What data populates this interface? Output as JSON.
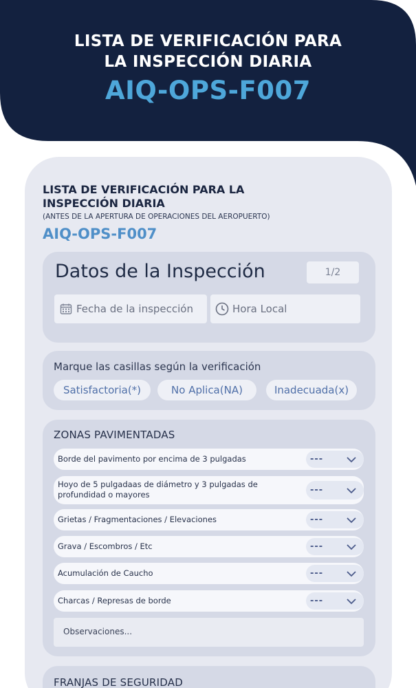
{
  "header": {
    "title_line1": "LISTA DE VERIFICACIÓN PARA",
    "title_line2": "LA INSPECCIÓN DIARIA",
    "code": "AIQ-OPS-F007"
  },
  "document": {
    "title_line1": "LISTA DE VERIFICACIÓN PARA LA",
    "title_line2": "INSPECCIÓN DIARIA",
    "subtitle": "(ANTES DE LA APERTURA DE OPERACIONES DEL AEROPUERTO)",
    "code": "AIQ-OPS-F007"
  },
  "inspection": {
    "title": "Datos de la Inspección",
    "page_indicator": "1/2",
    "date_placeholder": "Fecha de la  inspección",
    "time_placeholder": "Hora Local"
  },
  "legend": {
    "instruction": "Marque las casillas según la verificación",
    "options": [
      "Satisfactoria(*)",
      "No Aplica(NA)",
      "Inadecuada(x)"
    ]
  },
  "paved_zones": {
    "title": "ZONAS PAVIMENTADAS",
    "items": [
      {
        "label": "Borde del pavimento por encima de 3 pulgadas",
        "value": "---"
      },
      {
        "label": "Hoyo de 5 pulgadaas de diámetro y 3 pulgadas de",
        "label2": "profundidad o mayores",
        "value": "---"
      },
      {
        "label": "Grietas / Fragmentaciones / Elevaciones",
        "value": "---"
      },
      {
        "label": "Grava / Escombros / Etc",
        "value": "---"
      },
      {
        "label": "Acumulación de Caucho",
        "value": "---"
      },
      {
        "label": "Charcas / Represas de borde",
        "value": "---"
      }
    ],
    "observations_placeholder": "Observaciones..."
  },
  "safety_strips": {
    "title": "FRANJAS DE SEGURIDAD"
  },
  "colors": {
    "navy": "#13213f",
    "accent_blue": "#4ea7da",
    "panel": "#e7e9f1",
    "card": "#d5d9e6"
  }
}
